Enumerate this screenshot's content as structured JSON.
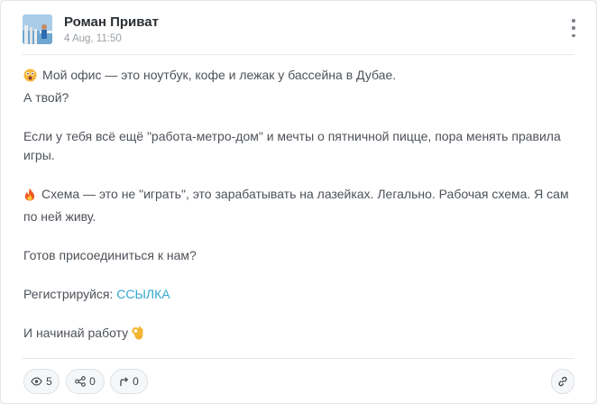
{
  "post": {
    "author": "Роман Приват",
    "date": "4 Aug, 11:50",
    "lines": {
      "l1": "Мой офис — это ноутбук, кофе и лежак у бассейна в Дубае.",
      "l2": "А твой?",
      "l3": "Если у тебя всё ещё \"работа-метро-дом\" и мечты о пятничной пицце, пора менять правила",
      "l4": "игры.",
      "l5": "Схема — это не \"играть\", это зарабатывать на лазейках. Легально. Рабочая схема. Я сам",
      "l6": "по ней живу.",
      "l7": "Готов присоединиться к нам?",
      "l8_prefix": "Регистрируйся:",
      "l8_link": "ССЫЛКА",
      "l9": "И начинай работу"
    },
    "emojis": [
      "astonished-face",
      "fire",
      "ok-hand"
    ]
  },
  "footer": {
    "views": "5",
    "shares": "0",
    "reposts": "0"
  },
  "colors": {
    "link": "#32a8d0",
    "text": "#4d5259",
    "author": "#2b2f33",
    "muted": "#9aa0a6"
  }
}
